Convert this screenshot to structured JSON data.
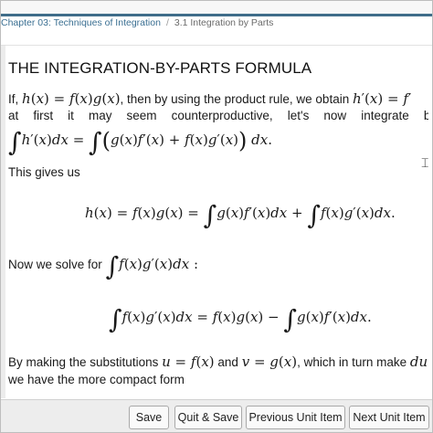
{
  "breadcrumb": {
    "chapter": "Chapter 03: Techniques of Integration",
    "separator": "/",
    "section": "3.1 Integration by Parts"
  },
  "content": {
    "title": "THE INTEGRATION-BY-PARTS FORMULA",
    "p1_if": "If,",
    "p1_mid": ", then by using the product rule, we obtain",
    "p2_words": [
      "at",
      "first",
      "it",
      "may",
      "seem",
      "counterproductive,",
      "let's",
      "now",
      "integrate",
      "bo"
    ],
    "p3": "This gives us",
    "p4": "Now we solve for",
    "p5_a": "By making the substitutions",
    "p5_and": "and",
    "p5_b": ", which in turn make",
    "p6": "we have the more compact form"
  },
  "footer": {
    "save": "Save",
    "quit_save": "Quit & Save",
    "previous": "Previous Unit Item",
    "next": "Next Unit Item"
  }
}
